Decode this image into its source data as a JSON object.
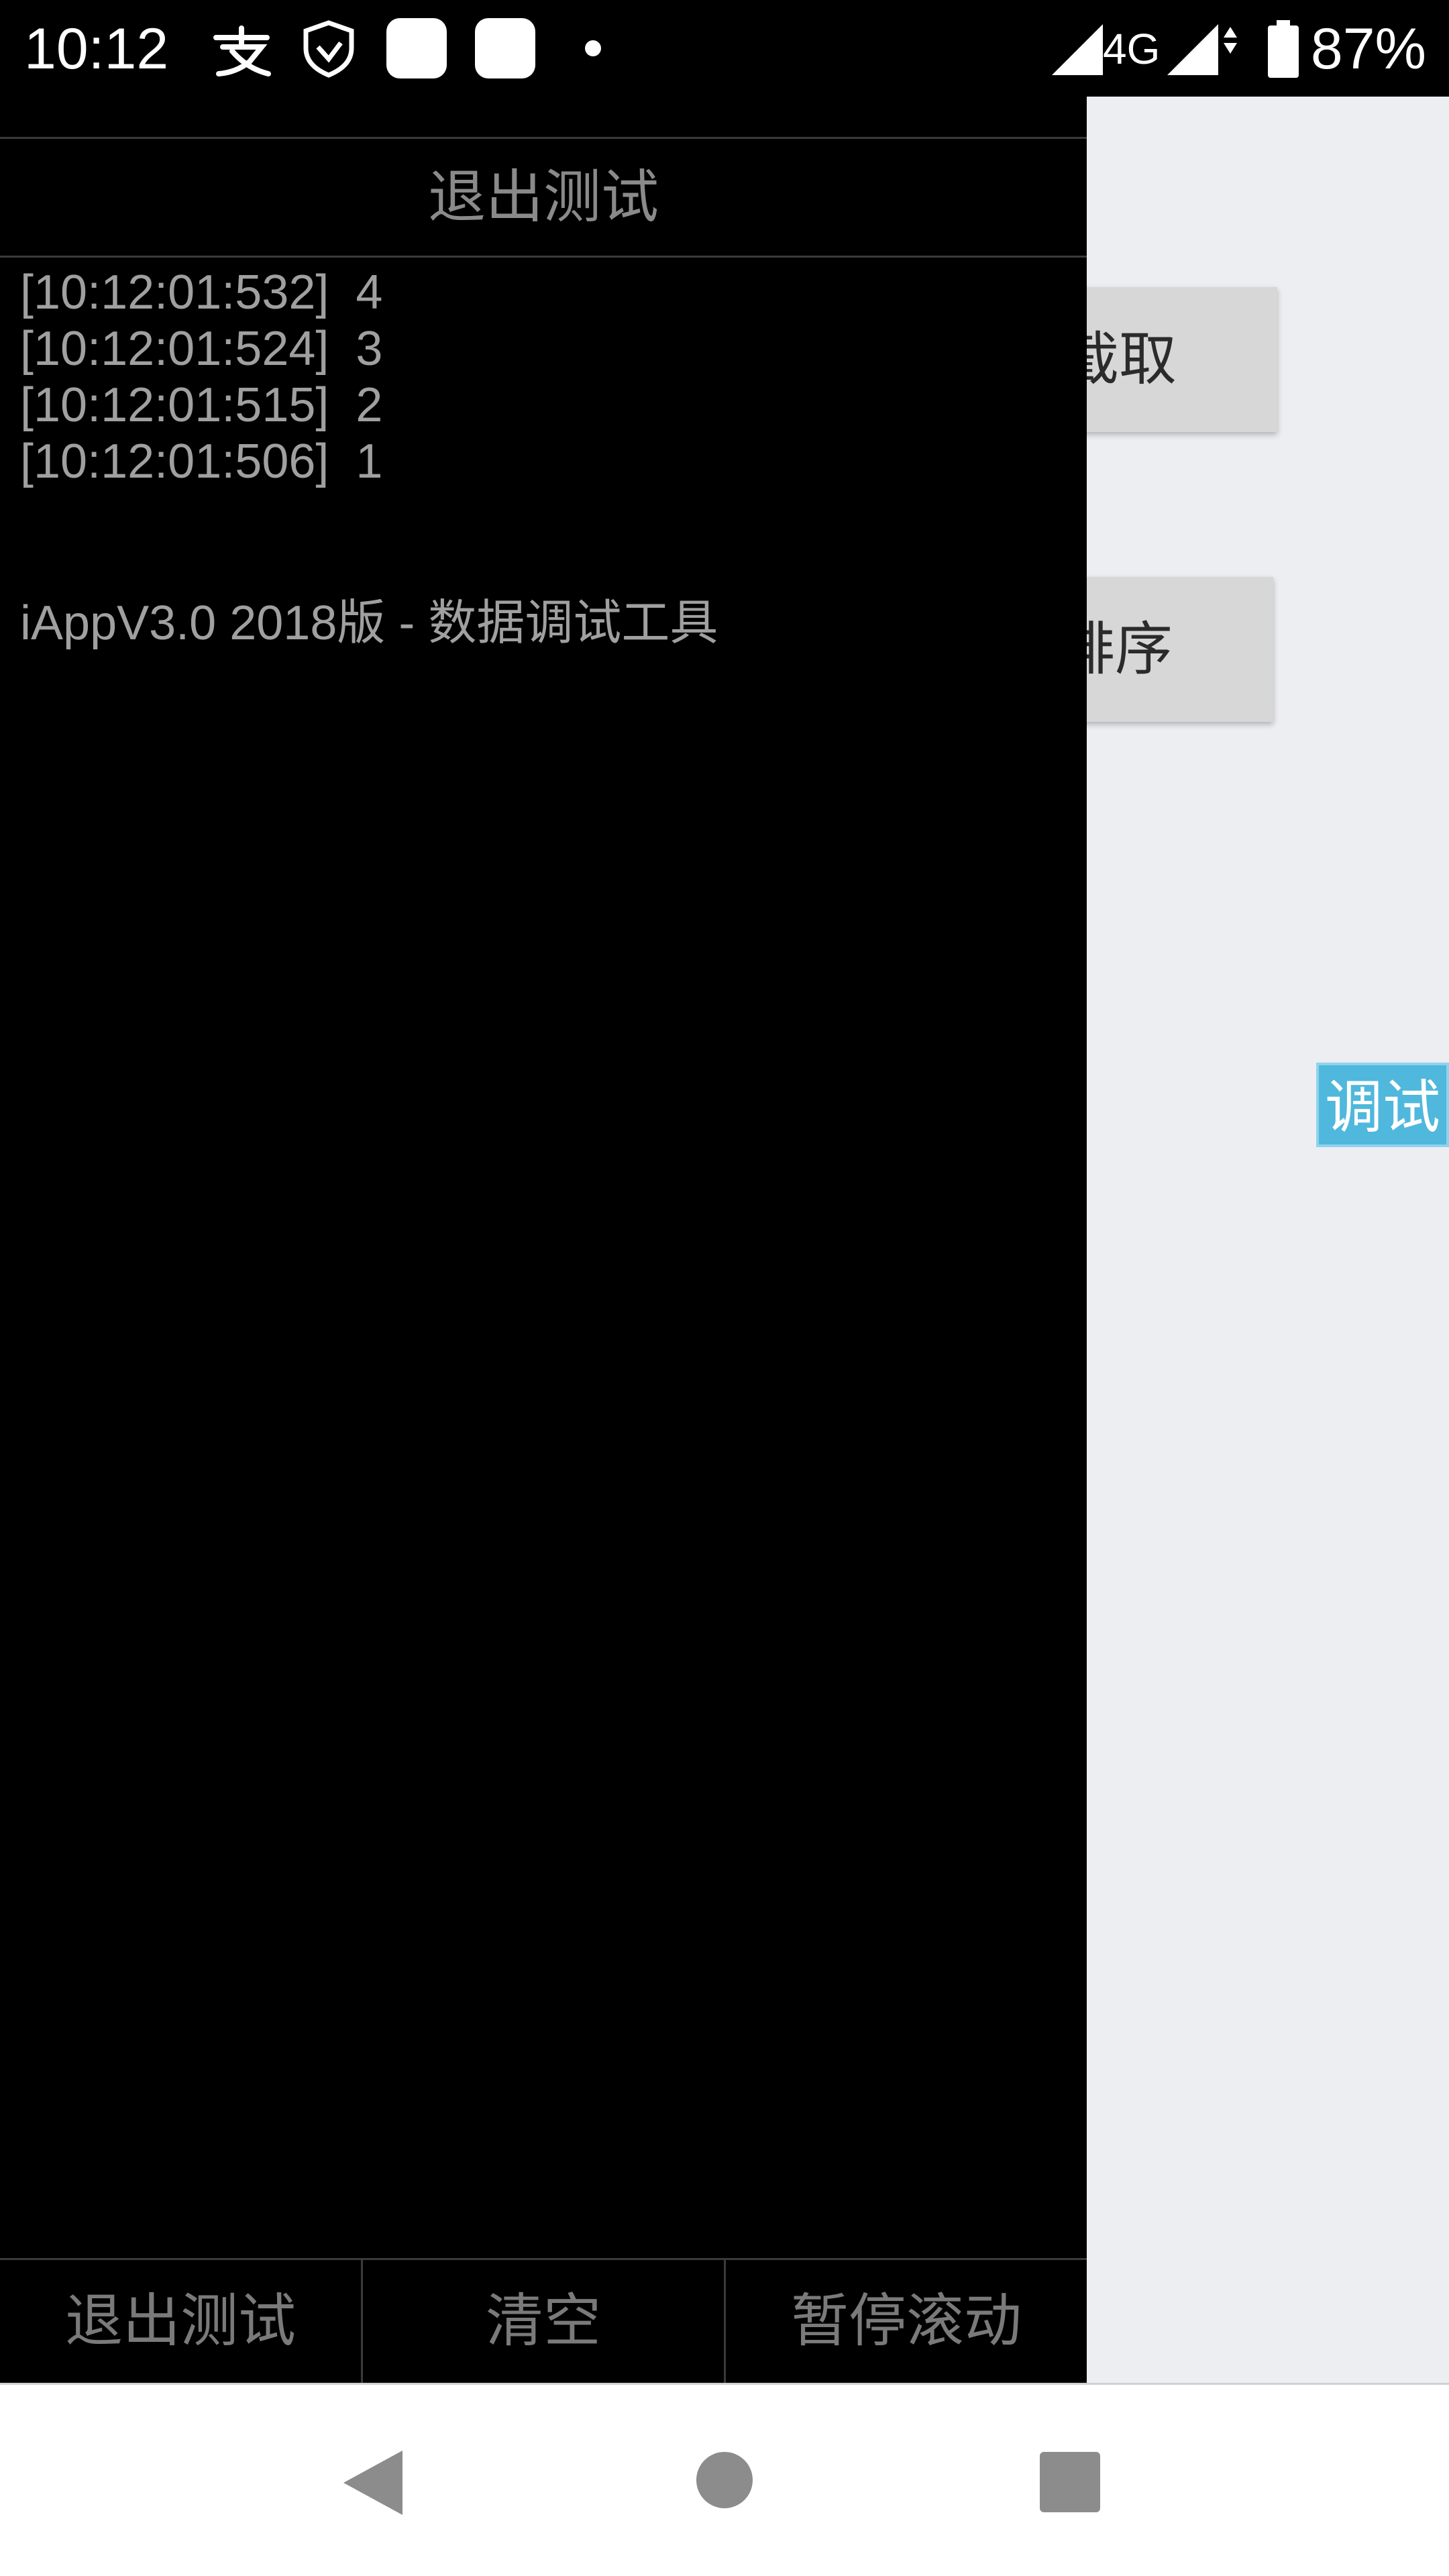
{
  "status_bar": {
    "time": "10:12",
    "network": "4G",
    "battery": "87%",
    "icons": [
      "alipay-icon",
      "shield-icon",
      "app-icon",
      "app-icon",
      "dot-icon",
      "signal-icon",
      "signal-data-icon",
      "battery-icon"
    ]
  },
  "background_app": {
    "button1_label": "截取",
    "button2_label": "排序",
    "debug_tag": "调试"
  },
  "debug_panel": {
    "title": "退出测试",
    "log": [
      "[10:12:01:532]  4",
      "[10:12:01:524]  3",
      "[10:12:01:515]  2",
      "[10:12:01:506]  1"
    ],
    "version_text": "iAppV3.0 2018版 - 数据调试工具",
    "bottom_buttons": {
      "exit": "退出测试",
      "clear": "清空",
      "pause": "暂停滚动"
    }
  },
  "nav_bar": {
    "buttons": [
      "back-icon",
      "home-icon",
      "recents-icon"
    ]
  },
  "colors": {
    "panel_bg": "#000000",
    "panel_text": "#a0a0a0",
    "accent": "#4fb8dc",
    "app_bg": "#edeef2"
  }
}
